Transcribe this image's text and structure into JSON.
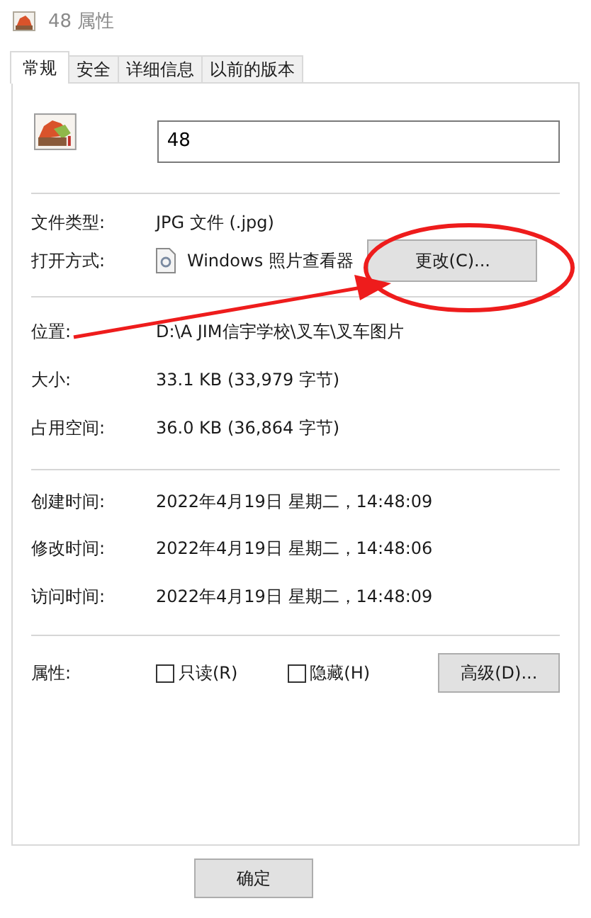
{
  "window": {
    "title": "48 属性"
  },
  "tabs": [
    {
      "label": "常规",
      "selected": true
    },
    {
      "label": "安全",
      "selected": false
    },
    {
      "label": "详细信息",
      "selected": false
    },
    {
      "label": "以前的版本",
      "selected": false
    }
  ],
  "file_name": {
    "value": "48"
  },
  "sections": [
    {
      "rows": [
        {
          "label": "文件类型:",
          "value": "JPG 文件 (.jpg)"
        },
        {
          "label": "打开方式:",
          "kind": "app",
          "value": "Windows 照片查看器",
          "button": "更改(C)..."
        }
      ]
    },
    {
      "rows": [
        {
          "label": "位置:",
          "value": "D:\\A JIM信宇学校\\叉车\\叉车图片"
        },
        {
          "label": "大小:",
          "value": "33.1 KB (33,979 字节)"
        },
        {
          "label": "占用空间:",
          "value": "36.0 KB (36,864 字节)"
        }
      ]
    },
    {
      "rows": [
        {
          "label": "创建时间:",
          "value": "2022年4月19日 星期二，14:48:09"
        },
        {
          "label": "修改时间:",
          "value": "2022年4月19日 星期二，14:48:06"
        },
        {
          "label": "访问时间:",
          "value": "2022年4月19日 星期二，14:48:09"
        }
      ]
    }
  ],
  "attributes": {
    "label": "属性:",
    "checkboxes": [
      {
        "label": "只读(R)",
        "checked": false
      },
      {
        "label": "隐藏(H)",
        "checked": false
      }
    ],
    "button": "高级(D)..."
  },
  "buttons": [
    "确定"
  ],
  "annotation": {
    "kind": "callout"
  }
}
